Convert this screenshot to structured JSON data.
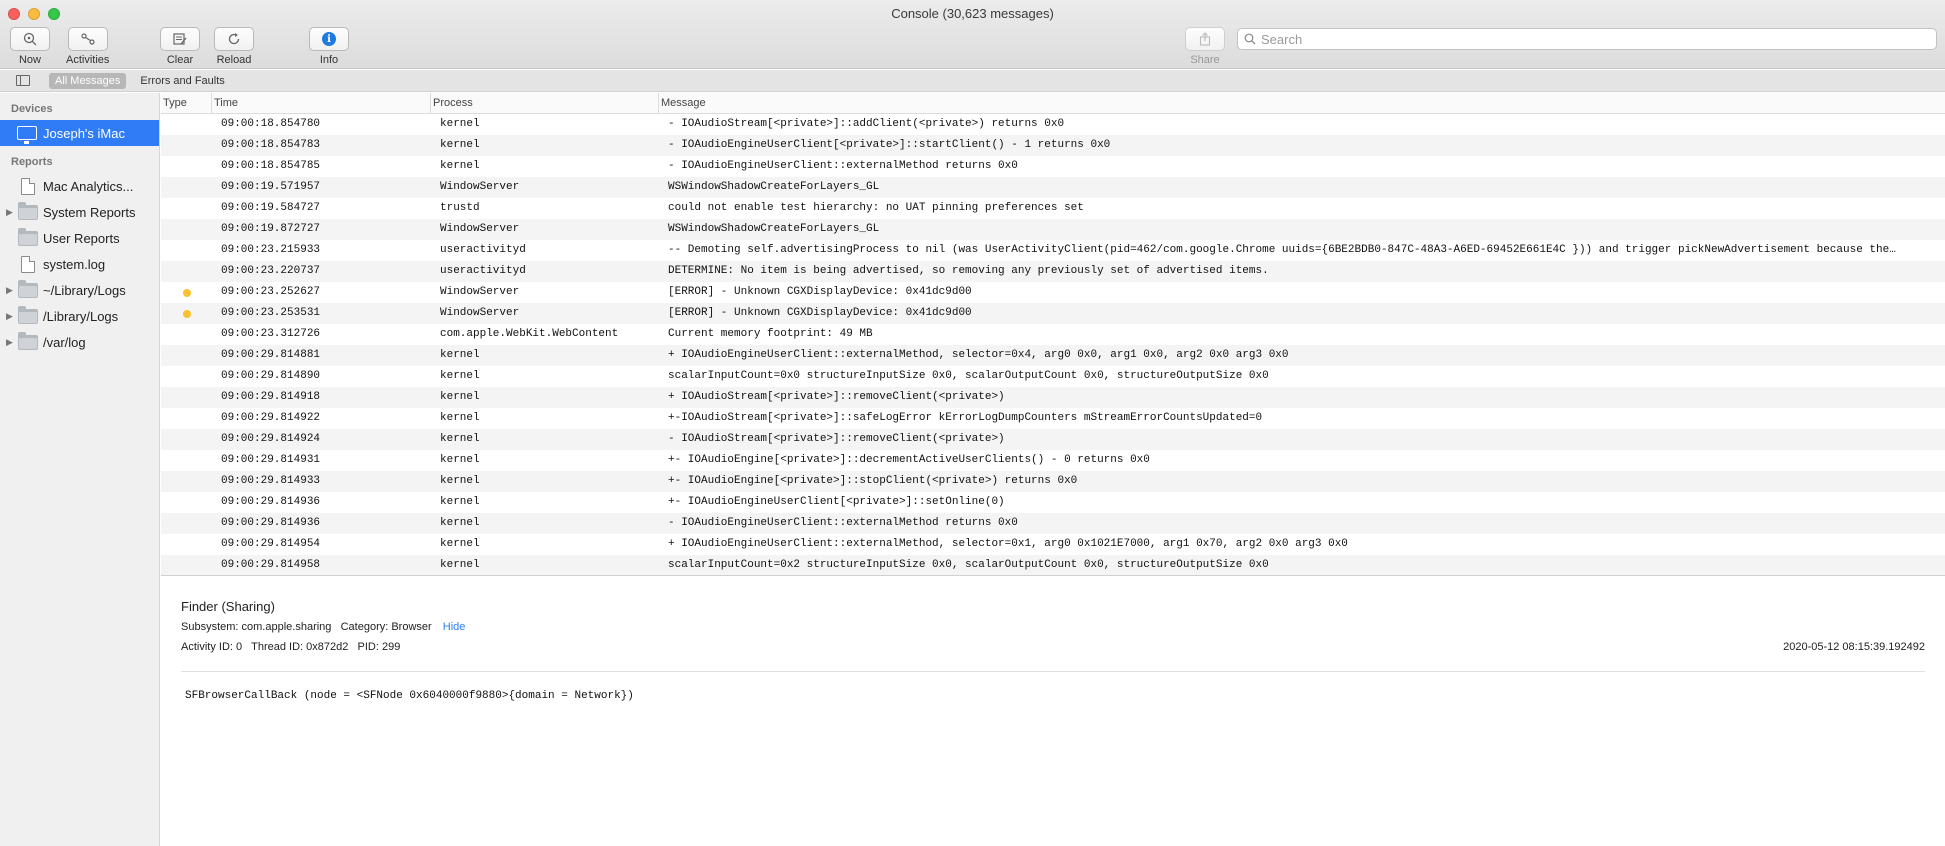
{
  "window": {
    "title": "Console (30,623 messages)"
  },
  "toolbar": {
    "now": "Now",
    "activities": "Activities",
    "clear": "Clear",
    "reload": "Reload",
    "info": "Info",
    "share": "Share",
    "search_placeholder": "Search"
  },
  "filters": {
    "all": "All Messages",
    "errors": "Errors and Faults"
  },
  "sidebar": {
    "devices_header": "Devices",
    "device": "Joseph's iMac",
    "reports_header": "Reports",
    "items": [
      {
        "label": "Mac Analytics...",
        "type": "doc",
        "expandable": false
      },
      {
        "label": "System Reports",
        "type": "folder",
        "expandable": true
      },
      {
        "label": "User Reports",
        "type": "folder",
        "expandable": false
      },
      {
        "label": "system.log",
        "type": "doc",
        "expandable": false
      },
      {
        "label": "~/Library/Logs",
        "type": "folder",
        "expandable": true
      },
      {
        "label": "/Library/Logs",
        "type": "folder",
        "expandable": true
      },
      {
        "label": "/var/log",
        "type": "folder",
        "expandable": true
      }
    ]
  },
  "columns": {
    "type": "Type",
    "time": "Time",
    "process": "Process",
    "message": "Message"
  },
  "messages": [
    {
      "type": "",
      "time": "09:00:18.854780",
      "process": "kernel",
      "message": "- IOAudioStream[<private>]::addClient(<private>) returns 0x0"
    },
    {
      "type": "",
      "time": "09:00:18.854783",
      "process": "kernel",
      "message": "- IOAudioEngineUserClient[<private>]::startClient() - 1 returns 0x0"
    },
    {
      "type": "",
      "time": "09:00:18.854785",
      "process": "kernel",
      "message": "- IOAudioEngineUserClient::externalMethod returns 0x0"
    },
    {
      "type": "",
      "time": "09:00:19.571957",
      "process": "WindowServer",
      "message": "WSWindowShadowCreateForLayers_GL"
    },
    {
      "type": "",
      "time": "09:00:19.584727",
      "process": "trustd",
      "message": "could not enable test hierarchy: no UAT pinning preferences set"
    },
    {
      "type": "",
      "time": "09:00:19.872727",
      "process": "WindowServer",
      "message": "WSWindowShadowCreateForLayers_GL"
    },
    {
      "type": "",
      "time": "09:00:23.215933",
      "process": "useractivityd",
      "message": "-- Demoting self.advertisingProcess to nil (was UserActivityClient(pid=462/com.google.Chrome uuids={6BE2BDB0-847C-48A3-A6ED-69452E661E4C })) and trigger pickNewAdvertisement because the…"
    },
    {
      "type": "",
      "time": "09:00:23.220737",
      "process": "useractivityd",
      "message": "DETERMINE: No item is being advertised, so removing any previously set of advertised items."
    },
    {
      "type": "error",
      "time": "09:00:23.252627",
      "process": "WindowServer",
      "message": "[ERROR] - Unknown CGXDisplayDevice: 0x41dc9d00"
    },
    {
      "type": "error",
      "time": "09:00:23.253531",
      "process": "WindowServer",
      "message": "[ERROR] - Unknown CGXDisplayDevice: 0x41dc9d00"
    },
    {
      "type": "",
      "time": "09:00:23.312726",
      "process": "com.apple.WebKit.WebContent",
      "message": "Current memory footprint: 49 MB"
    },
    {
      "type": "",
      "time": "09:00:29.814881",
      "process": "kernel",
      "message": "+ IOAudioEngineUserClient::externalMethod, selector=0x4,   arg0 0x0, arg1 0x0, arg2 0x0 arg3 0x0"
    },
    {
      "type": "",
      "time": "09:00:29.814890",
      "process": "kernel",
      "message": "  scalarInputCount=0x0  structureInputSize 0x0, scalarOutputCount 0x0, structureOutputSize 0x0"
    },
    {
      "type": "",
      "time": "09:00:29.814918",
      "process": "kernel",
      "message": "+ IOAudioStream[<private>]::removeClient(<private>)"
    },
    {
      "type": "",
      "time": "09:00:29.814922",
      "process": "kernel",
      "message": "+-IOAudioStream[<private>]::safeLogError kErrorLogDumpCounters mStreamErrorCountsUpdated=0"
    },
    {
      "type": "",
      "time": "09:00:29.814924",
      "process": "kernel",
      "message": "- IOAudioStream[<private>]::removeClient(<private>)"
    },
    {
      "type": "",
      "time": "09:00:29.814931",
      "process": "kernel",
      "message": "+- IOAudioEngine[<private>]::decrementActiveUserClients() - 0 returns 0x0"
    },
    {
      "type": "",
      "time": "09:00:29.814933",
      "process": "kernel",
      "message": "+- IOAudioEngine[<private>]::stopClient(<private>) returns 0x0"
    },
    {
      "type": "",
      "time": "09:00:29.814936",
      "process": "kernel",
      "message": "+- IOAudioEngineUserClient[<private>]::setOnline(0)"
    },
    {
      "type": "",
      "time": "09:00:29.814936",
      "process": "kernel",
      "message": "- IOAudioEngineUserClient::externalMethod returns 0x0"
    },
    {
      "type": "",
      "time": "09:00:29.814954",
      "process": "kernel",
      "message": "+ IOAudioEngineUserClient::externalMethod, selector=0x1,   arg0 0x1021E7000, arg1 0x70, arg2 0x0 arg3 0x0"
    },
    {
      "type": "",
      "time": "09:00:29.814958",
      "process": "kernel",
      "message": "  scalarInputCount=0x2  structureInputSize 0x0, scalarOutputCount 0x0, structureOutputSize 0x0"
    }
  ],
  "detail": {
    "title": "Finder (Sharing)",
    "subsystem": "Subsystem: com.apple.sharing",
    "category": "Category: Browser",
    "hide": "Hide",
    "activity_id": "Activity ID: 0",
    "thread_id": "Thread ID: 0x872d2",
    "pid": "PID: 299",
    "date": "2020-05-12 08:15:39.192492",
    "message": "SFBrowserCallBack (node = <SFNode 0x6040000f9880>{domain = Network})"
  },
  "colors": {
    "selection": "#2f7cf6",
    "error_dot": "#fbc02d",
    "link": "#2b7ff0"
  }
}
